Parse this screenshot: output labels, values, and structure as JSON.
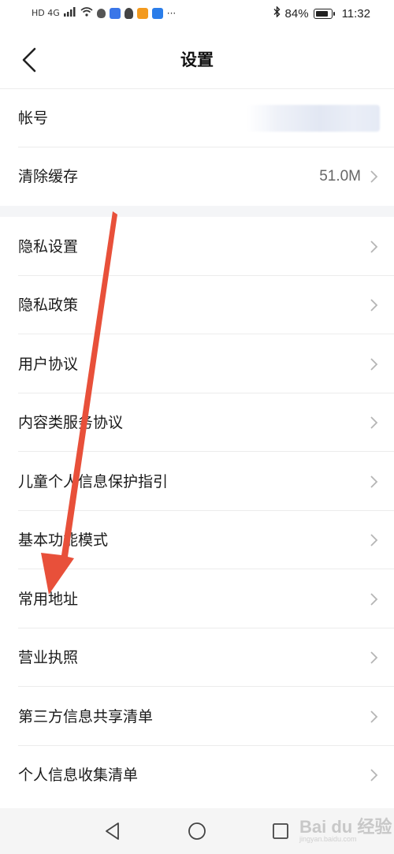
{
  "status_bar": {
    "left_text": "HD 4G",
    "battery": "84%",
    "time": "11:32"
  },
  "header": {
    "title": "设置"
  },
  "account_section": {
    "items": [
      {
        "label": "帐号",
        "value": ""
      },
      {
        "label": "清除缓存",
        "value": "51.0M"
      }
    ]
  },
  "settings_list": {
    "items": [
      {
        "label": "隐私设置"
      },
      {
        "label": "隐私政策"
      },
      {
        "label": "用户协议"
      },
      {
        "label": "内容类服务协议"
      },
      {
        "label": "儿童个人信息保护指引"
      },
      {
        "label": "基本功能模式"
      },
      {
        "label": "常用地址"
      },
      {
        "label": "营业执照"
      },
      {
        "label": "第三方信息共享清单"
      },
      {
        "label": "个人信息收集清单"
      }
    ]
  },
  "watermark": {
    "text": "Bai du 经验",
    "sub": "jingyan.baidu.com"
  },
  "colors": {
    "arrow": "#e8503a",
    "divider": "#ececec",
    "chevron": "#b5b5b5"
  }
}
